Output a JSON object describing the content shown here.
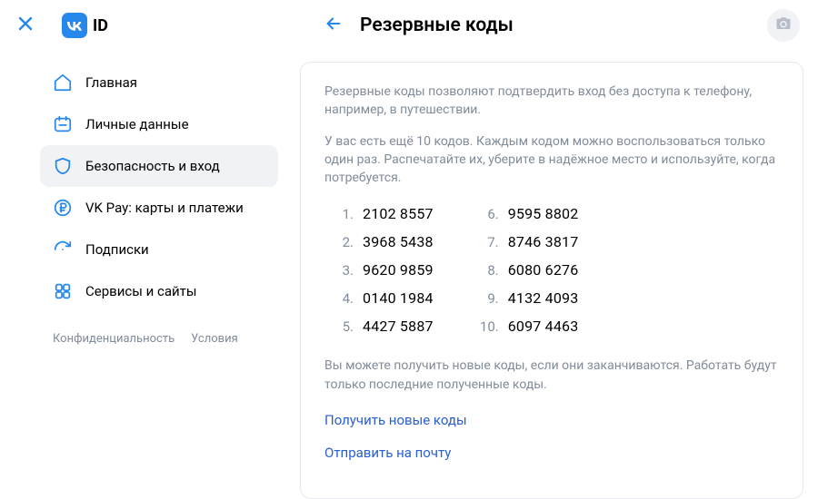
{
  "header": {
    "logo_text": "ID",
    "page_title": "Резервные коды"
  },
  "sidebar": {
    "items": [
      {
        "label": "Главная"
      },
      {
        "label": "Личные данные"
      },
      {
        "label": "Безопасность и вход"
      },
      {
        "label": "VK Pay: карты и платежи"
      },
      {
        "label": "Подписки"
      },
      {
        "label": "Сервисы и сайты"
      }
    ],
    "footer": {
      "privacy": "Конфиденциальность",
      "terms": "Условия"
    }
  },
  "content": {
    "desc1": "Резервные коды позволяют подтвердить вход без доступа к телефону, например, в путешествии.",
    "desc2": "У вас есть ещё 10 кодов. Каждым кодом можно воспользоваться только один раз. Распечатайте их, уберите в надёжное место и используйте, когда потребуется.",
    "codes": [
      "2102 8557",
      "3968 5438",
      "9620 9859",
      "0140 1984",
      "4427 5887",
      "9595 8802",
      "8746 3817",
      "6080 6276",
      "4132 4093",
      "6097 4463"
    ],
    "note": "Вы можете получить новые коды, если они заканчиваются. Работать будут только последние полученные коды.",
    "action_new": "Получить новые коды",
    "action_email": "Отправить на почту"
  }
}
